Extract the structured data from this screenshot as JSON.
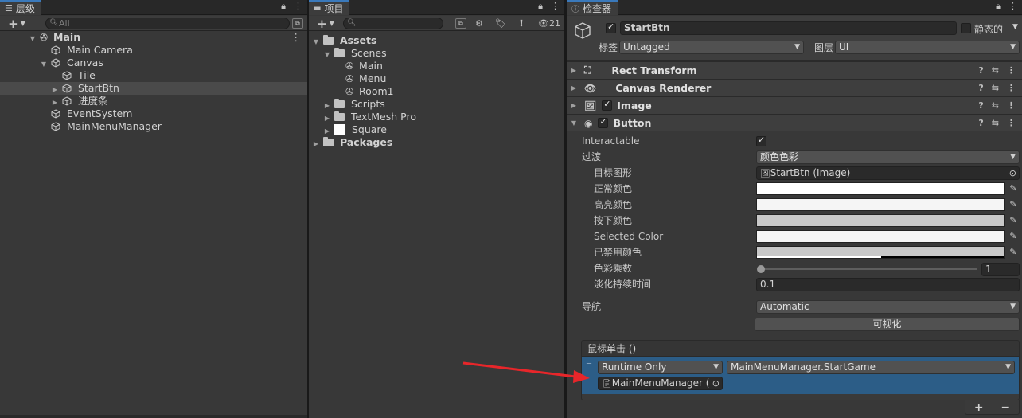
{
  "hierarchy": {
    "tab_label": "层级",
    "search_placeholder": "All",
    "items": [
      {
        "label": "Main"
      },
      {
        "label": "Main Camera"
      },
      {
        "label": "Canvas"
      },
      {
        "label": "Tile"
      },
      {
        "label": "StartBtn"
      },
      {
        "label": "进度条"
      },
      {
        "label": "EventSystem"
      },
      {
        "label": "MainMenuManager"
      }
    ]
  },
  "project": {
    "tab_label": "项目",
    "hidden_count": "21",
    "items": [
      {
        "label": "Assets"
      },
      {
        "label": "Scenes"
      },
      {
        "label": "Main"
      },
      {
        "label": "Menu"
      },
      {
        "label": "Room1"
      },
      {
        "label": "Scripts"
      },
      {
        "label": "TextMesh Pro"
      },
      {
        "label": "Square"
      },
      {
        "label": "Packages"
      }
    ]
  },
  "inspector": {
    "tab_label": "检查器",
    "object_name": "StartBtn",
    "static_label": "静态的",
    "tag_label": "标签",
    "tag_value": "Untagged",
    "layer_label": "图层",
    "layer_value": "UI",
    "components": [
      {
        "name": "Rect Transform"
      },
      {
        "name": "Canvas Renderer"
      },
      {
        "name": "Image"
      },
      {
        "name": "Button"
      }
    ],
    "button": {
      "interactable_label": "Interactable",
      "transition_label": "过渡",
      "transition_value": "颜色色彩",
      "target_graphic_label": "目标图形",
      "target_graphic_value": "StartBtn (Image)",
      "normal_color_label": "正常颜色",
      "highlighted_color_label": "高亮颜色",
      "pressed_color_label": "按下颜色",
      "selected_color_label": "Selected Color",
      "disabled_color_label": "已禁用颜色",
      "color_multiplier_label": "色彩乘数",
      "color_multiplier_value": "1",
      "fade_duration_label": "淡化持续时间",
      "fade_duration_value": "0.1",
      "navigation_label": "导航",
      "navigation_value": "Automatic",
      "visualize_label": "可视化",
      "onclick_label": "鼠标单击 ()",
      "runtime_value": "Runtime Only",
      "function_value": "MainMenuManager.StartGame",
      "object_value": "MainMenuManager (",
      "colors": {
        "normal": "#ffffff",
        "highlighted": "#f5f5f5",
        "pressed": "#c8c8c8",
        "selected": "#f5f5f5",
        "disabled": "#c8c8c8"
      }
    }
  },
  "colors": {
    "accent": "#3a79bb",
    "event_row": "#2c5d87",
    "arrow": "#e8262a"
  }
}
